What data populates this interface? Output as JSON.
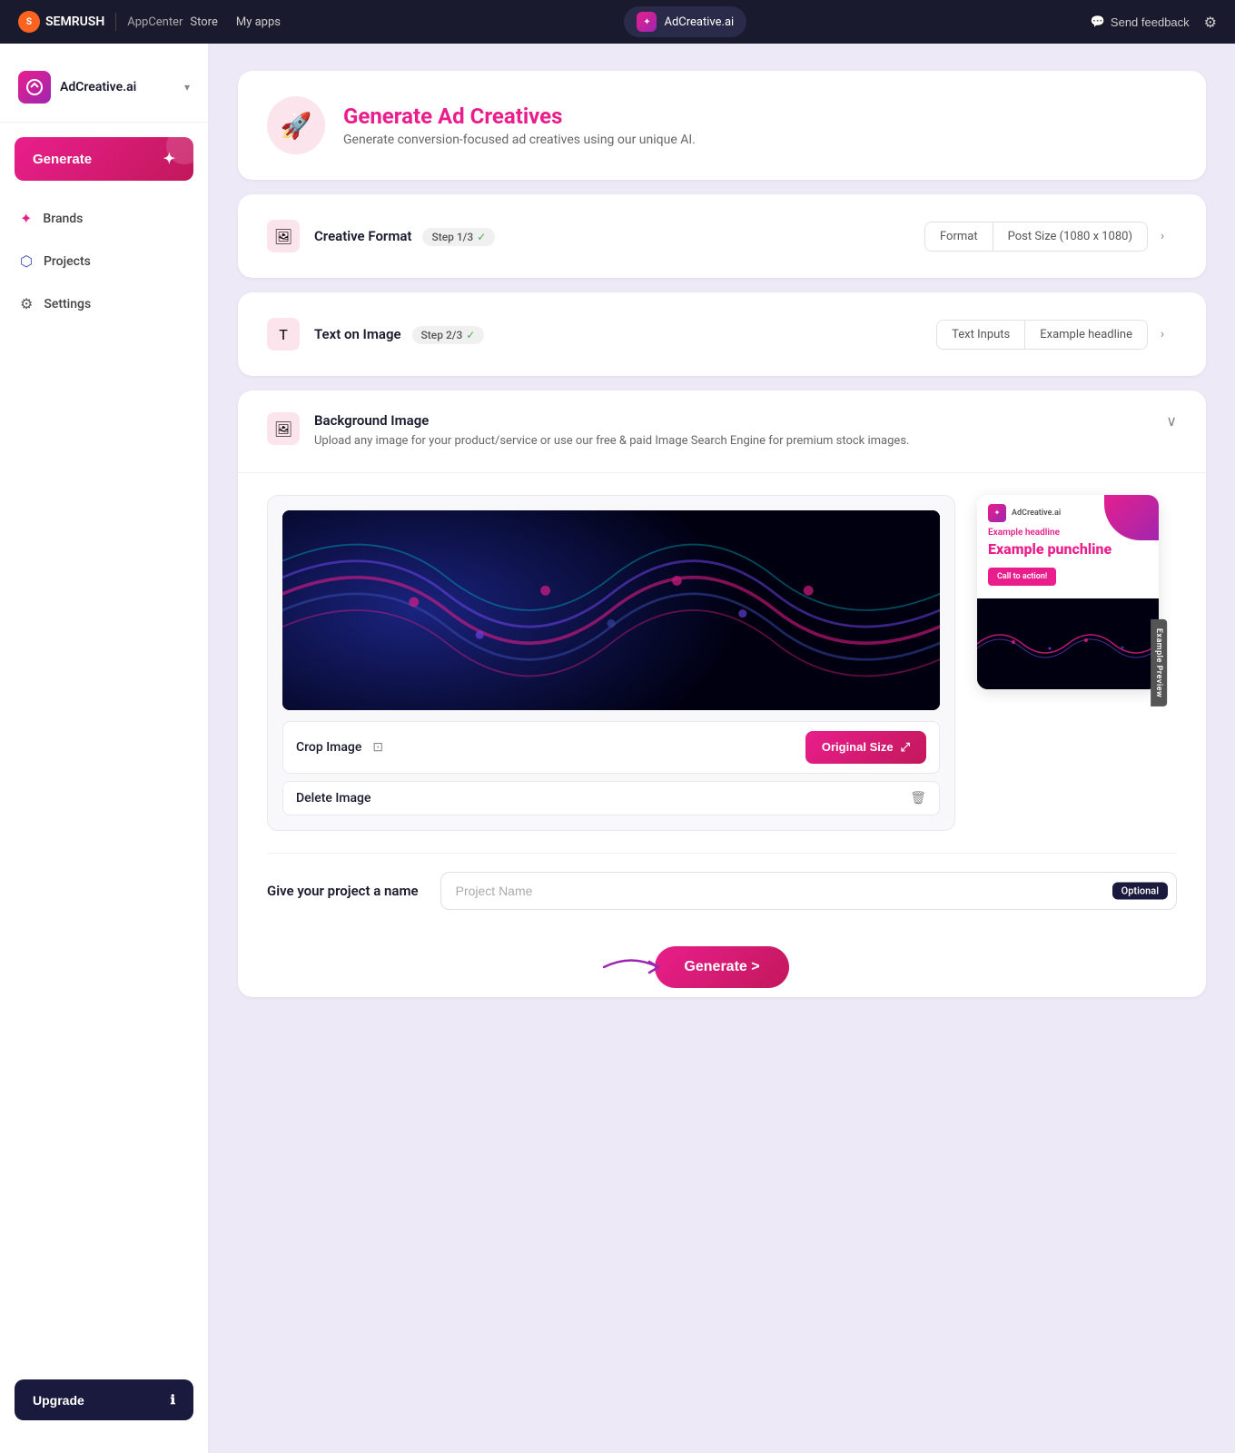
{
  "topnav": {
    "brand": "SEMRUSH",
    "appcenter": "AppCenter",
    "store": "Store",
    "myapps": "My apps",
    "app_name": "AdCreative.ai",
    "feedback": "Send feedback",
    "settings_icon": "gear-icon"
  },
  "sidebar": {
    "brand_name": "AdCreative.ai",
    "generate_label": "Generate",
    "nav_items": [
      {
        "id": "brands",
        "label": "Brands",
        "icon": "star-icon"
      },
      {
        "id": "projects",
        "label": "Projects",
        "icon": "box-icon"
      },
      {
        "id": "settings",
        "label": "Settings",
        "icon": "gear-icon"
      }
    ],
    "upgrade_label": "Upgrade"
  },
  "main": {
    "header": {
      "title": "Generate Ad Creatives",
      "subtitle": "Generate conversion-focused ad creatives using our unique AI."
    },
    "steps": [
      {
        "id": "creative-format",
        "icon": "format-icon",
        "title": "Creative Format",
        "badge": "Step 1/3",
        "checked": true,
        "pills": [
          {
            "label": "Format"
          },
          {
            "label": "Post Size (1080 x 1080)"
          }
        ]
      },
      {
        "id": "text-on-image",
        "icon": "text-icon",
        "title": "Text on Image",
        "badge": "Step 2/3",
        "checked": true,
        "pills": [
          {
            "label": "Text Inputs"
          },
          {
            "label": "Example headline"
          }
        ]
      }
    ],
    "background": {
      "title": "Background Image",
      "subtitle": "Upload any image for your product/service or use our free & paid Image Search Engine for premium stock images.",
      "image_section": {
        "crop_label": "Crop Image",
        "original_size_label": "Original Size",
        "delete_label": "Delete Image"
      }
    },
    "preview": {
      "tab_label": "Example Preview",
      "headline": "Example headline",
      "punchline": "Example punchline",
      "cta": "Call to action!",
      "brand_name": "AdCreative.ai"
    },
    "project": {
      "label": "Give your project a name",
      "placeholder": "Project Name",
      "optional_label": "Optional"
    },
    "generate_btn": "Generate >"
  }
}
